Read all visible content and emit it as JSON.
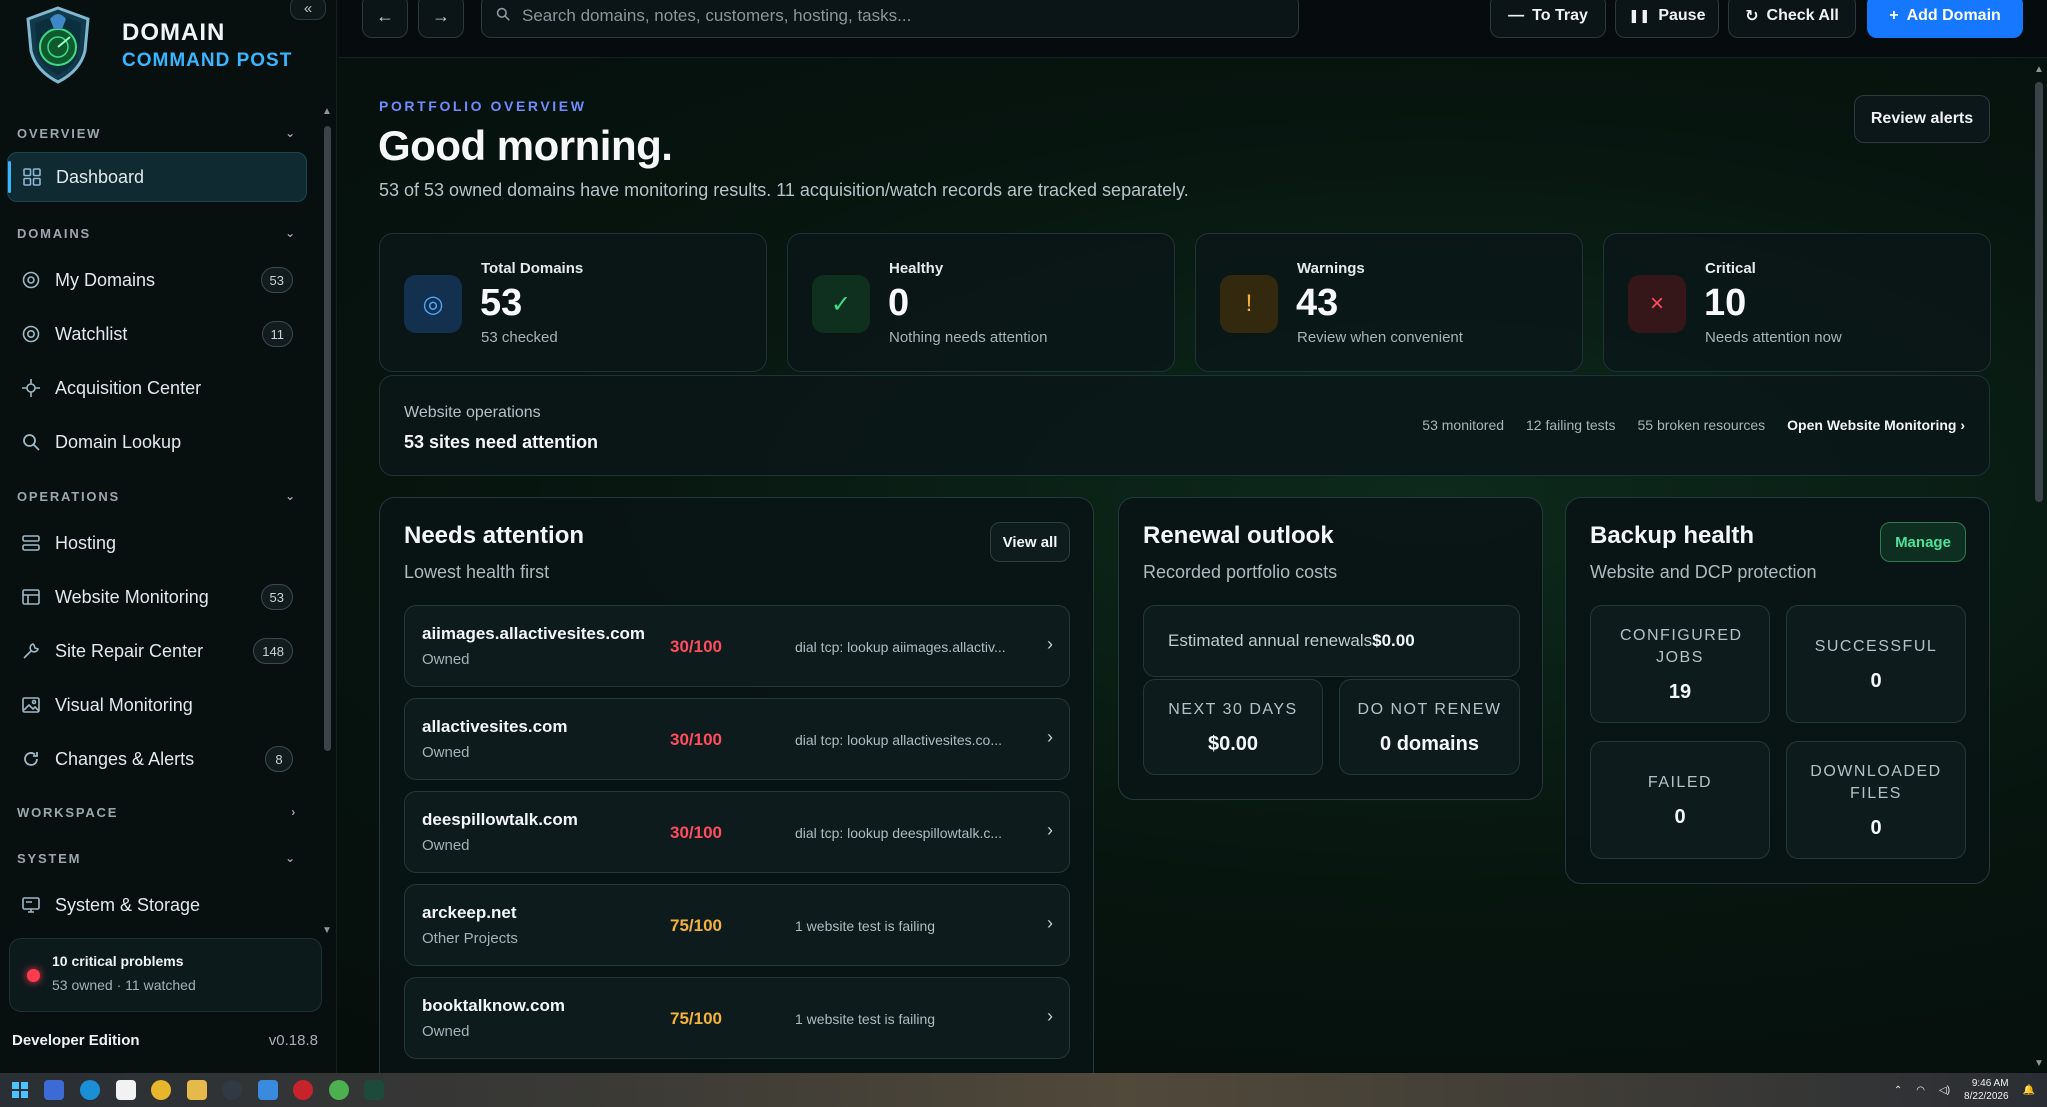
{
  "brand": {
    "line1": "DOMAIN",
    "line2": "COMMAND POST",
    "collapse_icon": "«"
  },
  "sidebar": {
    "sections": [
      {
        "label": "OVERVIEW",
        "chevron": "⌄"
      },
      {
        "label": "DOMAINS",
        "chevron": "⌄"
      },
      {
        "label": "OPERATIONS",
        "chevron": "⌄"
      },
      {
        "label": "WORKSPACE",
        "chevron": "›"
      },
      {
        "label": "SYSTEM",
        "chevron": "⌄"
      }
    ],
    "items": [
      {
        "label": "Dashboard",
        "icon": "grid-icon",
        "badge": ""
      },
      {
        "label": "My Domains",
        "icon": "globe-icon",
        "badge": "53"
      },
      {
        "label": "Watchlist",
        "icon": "eye-icon",
        "badge": "11"
      },
      {
        "label": "Acquisition Center",
        "icon": "target-icon",
        "badge": ""
      },
      {
        "label": "Domain Lookup",
        "icon": "search-icon",
        "badge": ""
      },
      {
        "label": "Hosting",
        "icon": "server-icon",
        "badge": ""
      },
      {
        "label": "Website Monitoring",
        "icon": "monitor-icon",
        "badge": "53"
      },
      {
        "label": "Site Repair Center",
        "icon": "wrench-icon",
        "badge": "148"
      },
      {
        "label": "Visual Monitoring",
        "icon": "image-icon",
        "badge": ""
      },
      {
        "label": "Changes & Alerts",
        "icon": "refresh-icon",
        "badge": "8"
      },
      {
        "label": "System & Storage",
        "icon": "desktop-icon",
        "badge": ""
      }
    ],
    "problems": {
      "title": "10 critical problems",
      "detail": "53 owned · 11 watched"
    },
    "edition": {
      "name": "Developer Edition",
      "version": "v0.18.8"
    }
  },
  "topbar": {
    "back": "←",
    "forward": "→",
    "search_placeholder": "Search domains, notes, customers, hosting, tasks...",
    "to_tray": "To Tray",
    "pause": "Pause",
    "check_all": "Check All",
    "add_domain": "Add Domain"
  },
  "header": {
    "eyebrow": "PORTFOLIO OVERVIEW",
    "greeting": "Good morning.",
    "subtitle": "53 of 53 owned domains have monitoring results. 11 acquisition/watch records are tracked separately.",
    "review_alerts": "Review alerts"
  },
  "stats": [
    {
      "label": "Total Domains",
      "value": "53",
      "sub": "53 checked",
      "glyph": "◎",
      "color": "#4aa8ff"
    },
    {
      "label": "Healthy",
      "value": "0",
      "sub": "Nothing needs attention",
      "glyph": "✓",
      "color": "#3ddc84"
    },
    {
      "label": "Warnings",
      "value": "43",
      "sub": "Review when convenient",
      "glyph": "!",
      "color": "#f5b23a"
    },
    {
      "label": "Critical",
      "value": "10",
      "sub": "Needs attention now",
      "glyph": "×",
      "color": "#ff4d5e"
    }
  ],
  "website_ops": {
    "label": "Website operations",
    "headline": "53 sites need attention",
    "monitored": "53 monitored",
    "failing": "12 failing tests",
    "broken": "55 broken resources",
    "link": "Open Website Monitoring ›"
  },
  "needs_attention": {
    "title": "Needs attention",
    "subtitle": "Lowest health first",
    "view_all": "View all",
    "rows": [
      {
        "domain": "aiimages.allactivesites.com",
        "group": "Owned",
        "score": "30/100",
        "message": "dial tcp: lookup aiimages.allactiv...",
        "level": "critical"
      },
      {
        "domain": "allactivesites.com",
        "group": "Owned",
        "score": "30/100",
        "message": "dial tcp: lookup allactivesites.co...",
        "level": "critical"
      },
      {
        "domain": "deespillowtalk.com",
        "group": "Owned",
        "score": "30/100",
        "message": "dial tcp: lookup deespillowtalk.c...",
        "level": "critical"
      },
      {
        "domain": "arckeep.net",
        "group": "Other Projects",
        "score": "75/100",
        "message": "1 website test is failing",
        "level": "warning"
      },
      {
        "domain": "booktalknow.com",
        "group": "Owned",
        "score": "75/100",
        "message": "1 website test is failing",
        "level": "warning"
      }
    ]
  },
  "renewal": {
    "title": "Renewal outlook",
    "subtitle": "Recorded portfolio costs",
    "annual_label": "Estimated annual renewals",
    "annual_value": "$0.00",
    "next30_label": "NEXT 30 DAYS",
    "next30_value": "$0.00",
    "dnr_label": "DO NOT RENEW",
    "dnr_value": "0 domains"
  },
  "backup": {
    "title": "Backup health",
    "subtitle": "Website and DCP protection",
    "manage": "Manage",
    "configured_label": "CONFIGURED JOBS",
    "configured_value": "19",
    "successful_label": "SUCCESSFUL",
    "successful_value": "0",
    "failed_label": "FAILED",
    "failed_value": "0",
    "downloaded_label": "DOWNLOADED FILES",
    "downloaded_value": "0"
  },
  "taskbar": {
    "time": "9:46 AM",
    "date": "8/22/2026"
  },
  "colors": {
    "accent": "#1677ff",
    "critical": "#ff4d5e",
    "warning": "#f5b23a",
    "healthy": "#3ddc84",
    "brand_blue": "#38b6ff"
  }
}
